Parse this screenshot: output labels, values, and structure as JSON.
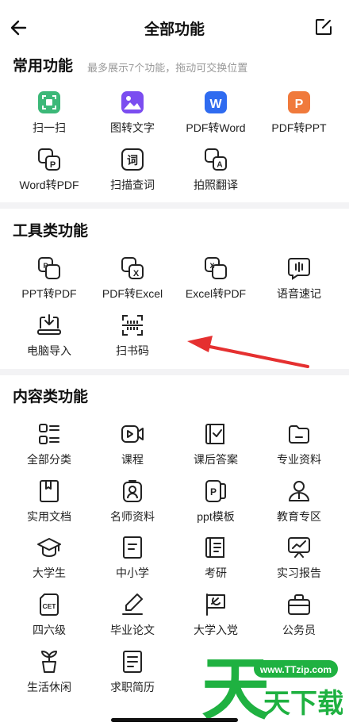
{
  "header": {
    "title": "全部功能",
    "back_icon": "back-arrow-icon",
    "edit_icon": "edit-icon"
  },
  "common": {
    "title": "常用功能",
    "subtitle": "最多展示7个功能，拖动可交换位置",
    "items": [
      {
        "label": "扫一扫",
        "icon": "scan-icon",
        "color": "#3cb878"
      },
      {
        "label": "图转文字",
        "icon": "image-to-text-icon",
        "color": "#7b4df0"
      },
      {
        "label": "PDF转Word",
        "icon": "pdf-to-word-icon",
        "color": "#2f6bf0"
      },
      {
        "label": "PDF转PPT",
        "icon": "pdf-to-ppt-icon",
        "color": "#f07a3c"
      },
      {
        "label": "Word转PDF",
        "icon": "word-to-pdf-icon",
        "color": "#222222"
      },
      {
        "label": "扫描查词",
        "icon": "scan-word-icon",
        "color": "#222222"
      },
      {
        "label": "拍照翻译",
        "icon": "photo-translate-icon",
        "color": "#222222"
      }
    ]
  },
  "tools": {
    "title": "工具类功能",
    "items": [
      {
        "label": "PPT转PDF",
        "icon": "ppt-to-pdf-icon"
      },
      {
        "label": "PDF转Excel",
        "icon": "pdf-to-excel-icon"
      },
      {
        "label": "Excel转PDF",
        "icon": "excel-to-pdf-icon"
      },
      {
        "label": "语音速记",
        "icon": "voice-note-icon"
      },
      {
        "label": "电脑导入",
        "icon": "pc-import-icon"
      },
      {
        "label": "扫书码",
        "icon": "scan-book-code-icon"
      }
    ]
  },
  "content": {
    "title": "内容类功能",
    "items": [
      {
        "label": "全部分类",
        "icon": "all-categories-icon"
      },
      {
        "label": "课程",
        "icon": "course-icon"
      },
      {
        "label": "课后答案",
        "icon": "answers-icon"
      },
      {
        "label": "专业资料",
        "icon": "folder-icon"
      },
      {
        "label": "实用文档",
        "icon": "document-icon"
      },
      {
        "label": "名师资料",
        "icon": "teacher-icon"
      },
      {
        "label": "ppt模板",
        "icon": "ppt-template-icon"
      },
      {
        "label": "教育专区",
        "icon": "education-icon"
      },
      {
        "label": "大学生",
        "icon": "graduation-cap-icon"
      },
      {
        "label": "中小学",
        "icon": "school-icon"
      },
      {
        "label": "考研",
        "icon": "exam-icon"
      },
      {
        "label": "实习报告",
        "icon": "report-icon"
      },
      {
        "label": "四六级",
        "icon": "cet-icon"
      },
      {
        "label": "毕业论文",
        "icon": "thesis-icon"
      },
      {
        "label": "大学入党",
        "icon": "party-flag-icon"
      },
      {
        "label": "公务员",
        "icon": "civil-servant-icon"
      },
      {
        "label": "生活休闲",
        "icon": "leisure-icon"
      },
      {
        "label": "求职简历",
        "icon": "resume-icon"
      }
    ]
  },
  "watermark": {
    "domain": "www.TTzip.com",
    "brand_big": "天",
    "brand_small": "天下载"
  },
  "colors": {
    "annotation_arrow": "#e53030",
    "watermark_green": "#1fb141"
  }
}
